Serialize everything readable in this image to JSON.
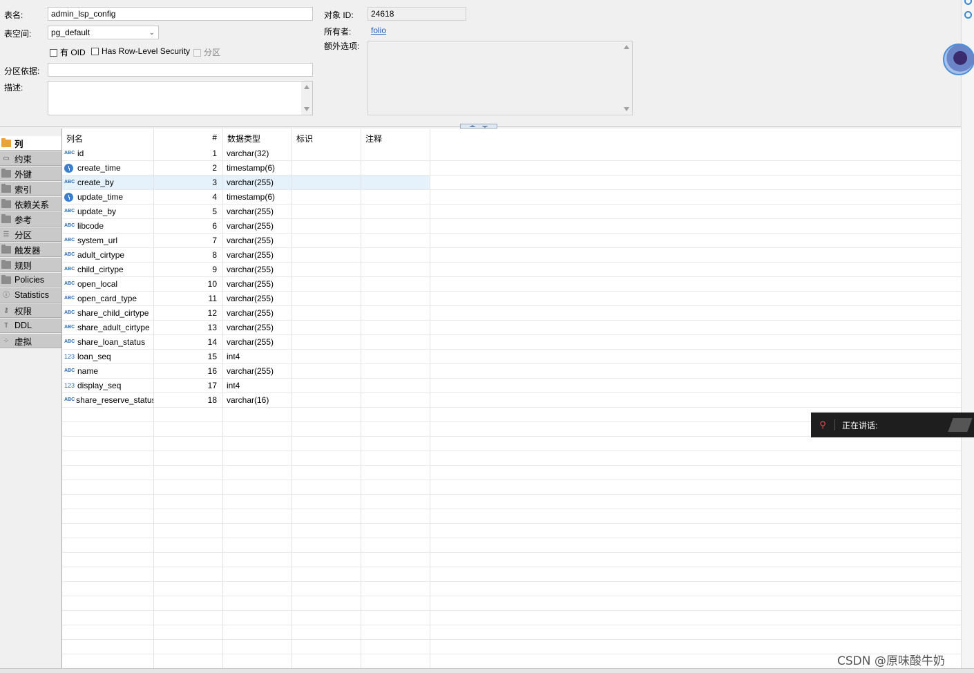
{
  "form": {
    "table_name_label": "表名:",
    "table_name_value": "admin_lsp_config",
    "tablespace_label": "表空间:",
    "tablespace_value": "pg_default",
    "has_oid_label": "有 OID",
    "rls_label": "Has Row-Level Security",
    "partition_label": "分区",
    "partition_by_label": "分区依据:",
    "partition_by_value": "",
    "description_label": "描述:",
    "object_id_label": "对象 ID:",
    "object_id_value": "24618",
    "owner_label": "所有者:",
    "owner_value": "folio",
    "extra_options_label": "额外选项:"
  },
  "tabs": [
    {
      "label": "列",
      "icon": "columns-folder-icon",
      "active": true
    },
    {
      "label": "约束",
      "icon": "constraint-icon"
    },
    {
      "label": "外键",
      "icon": "folder-icon"
    },
    {
      "label": "索引",
      "icon": "folder-icon"
    },
    {
      "label": "依赖关系",
      "icon": "folder-icon"
    },
    {
      "label": "参考",
      "icon": "folder-icon"
    },
    {
      "label": "分区",
      "icon": "partition-icon"
    },
    {
      "label": "触发器",
      "icon": "folder-icon"
    },
    {
      "label": "规则",
      "icon": "folder-icon"
    },
    {
      "label": "Policies",
      "icon": "folder-icon"
    },
    {
      "label": "Statistics",
      "icon": "info-icon"
    },
    {
      "label": "权限",
      "icon": "key-icon"
    },
    {
      "label": "DDL",
      "icon": "ddl-icon"
    },
    {
      "label": "虚拟",
      "icon": "virtual-icon"
    }
  ],
  "grid": {
    "headers": [
      "列名",
      "#",
      "数据类型",
      "标识",
      "注释"
    ],
    "rows": [
      {
        "name": "id",
        "num": "1",
        "type": "varchar(32)",
        "icon": "ABC"
      },
      {
        "name": "create_time",
        "num": "2",
        "type": "timestamp(6)",
        "icon": "clock"
      },
      {
        "name": "create_by",
        "num": "3",
        "type": "varchar(255)",
        "icon": "ABC",
        "selected": true
      },
      {
        "name": "update_time",
        "num": "4",
        "type": "timestamp(6)",
        "icon": "clock"
      },
      {
        "name": "update_by",
        "num": "5",
        "type": "varchar(255)",
        "icon": "ABC"
      },
      {
        "name": "libcode",
        "num": "6",
        "type": "varchar(255)",
        "icon": "ABC"
      },
      {
        "name": "system_url",
        "num": "7",
        "type": "varchar(255)",
        "icon": "ABC"
      },
      {
        "name": "adult_cirtype",
        "num": "8",
        "type": "varchar(255)",
        "icon": "ABC"
      },
      {
        "name": "child_cirtype",
        "num": "9",
        "type": "varchar(255)",
        "icon": "ABC"
      },
      {
        "name": "open_local",
        "num": "10",
        "type": "varchar(255)",
        "icon": "ABC"
      },
      {
        "name": "open_card_type",
        "num": "11",
        "type": "varchar(255)",
        "icon": "ABC"
      },
      {
        "name": "share_child_cirtype",
        "num": "12",
        "type": "varchar(255)",
        "icon": "ABC"
      },
      {
        "name": "share_adult_cirtype",
        "num": "13",
        "type": "varchar(255)",
        "icon": "ABC"
      },
      {
        "name": "share_loan_status",
        "num": "14",
        "type": "varchar(255)",
        "icon": "ABC"
      },
      {
        "name": "loan_seq",
        "num": "15",
        "type": "int4",
        "icon": "123"
      },
      {
        "name": "name",
        "num": "16",
        "type": "varchar(255)",
        "icon": "ABC"
      },
      {
        "name": "display_seq",
        "num": "17",
        "type": "int4",
        "icon": "123"
      },
      {
        "name": "share_reserve_status",
        "num": "18",
        "type": "varchar(16)",
        "icon": "ABC"
      }
    ]
  },
  "overlay": {
    "speaking_label": "正在讲话:",
    "watermark": "CSDN @原味酸牛奶"
  }
}
